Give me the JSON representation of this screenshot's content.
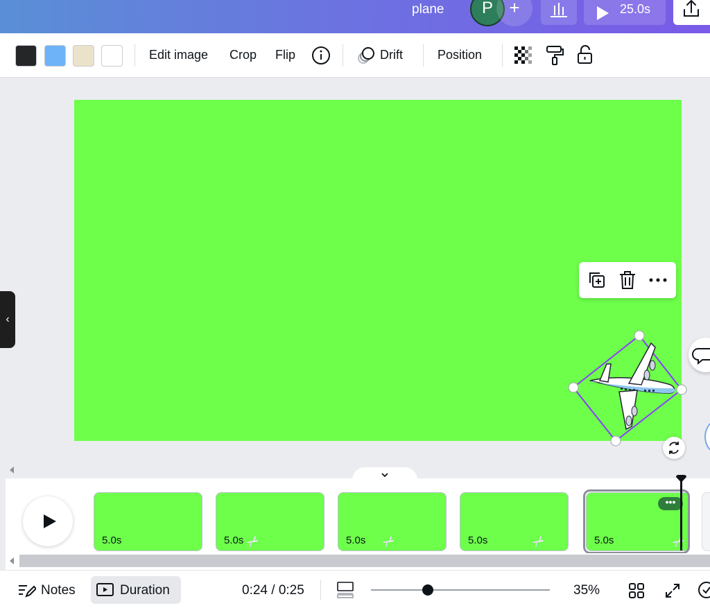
{
  "header": {
    "title": "plane",
    "avatar_initial": "P",
    "add_label": "+",
    "play_duration": "25.0s"
  },
  "toolbar": {
    "swatches": [
      "#242628",
      "#6eb3f7",
      "#ebe3c9",
      "#ffffff"
    ],
    "edit_image": "Edit image",
    "crop": "Crop",
    "flip": "Flip",
    "animation": "Drift",
    "position": "Position"
  },
  "canvas": {
    "background": "#6dff4a"
  },
  "timeline": {
    "clips": [
      {
        "duration": "5.0s",
        "transition": false
      },
      {
        "duration": "5.0s",
        "transition": true
      },
      {
        "duration": "5.0s",
        "transition": true
      },
      {
        "duration": "5.0s",
        "transition": true
      },
      {
        "duration": "5.0s",
        "transition": true,
        "selected": true
      }
    ],
    "more_label": "•••"
  },
  "footer": {
    "notes": "Notes",
    "duration": "Duration",
    "time": "0:24 / 0:25",
    "zoom": "35%"
  }
}
